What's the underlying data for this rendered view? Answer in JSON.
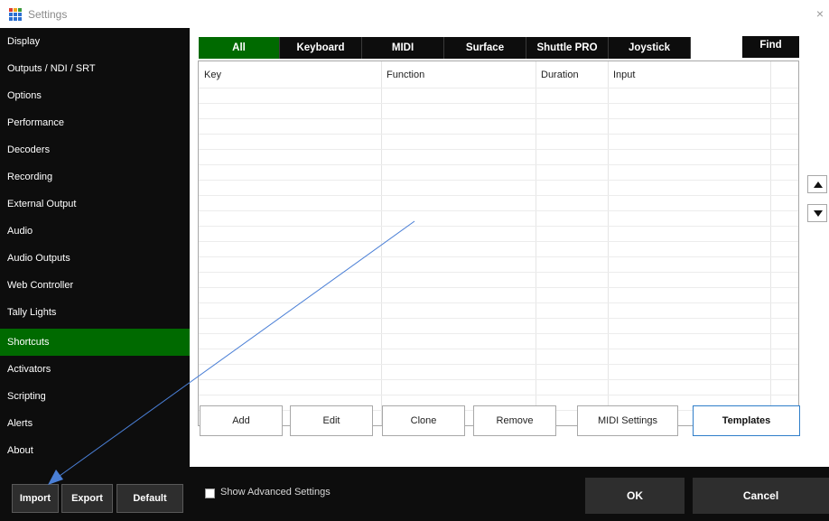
{
  "window": {
    "title": "Settings",
    "close_glyph": "×"
  },
  "sidebar": {
    "items": [
      {
        "label": "Display",
        "active": false
      },
      {
        "label": "Outputs / NDI / SRT",
        "active": false
      },
      {
        "label": "Options",
        "active": false
      },
      {
        "label": "Performance",
        "active": false
      },
      {
        "label": "Decoders",
        "active": false
      },
      {
        "label": "Recording",
        "active": false
      },
      {
        "label": "External Output",
        "active": false
      },
      {
        "label": "Audio",
        "active": false
      },
      {
        "label": "Audio Outputs",
        "active": false
      },
      {
        "label": "Web Controller",
        "active": false
      },
      {
        "label": "Tally Lights",
        "active": false
      },
      {
        "label": "Shortcuts",
        "active": true
      },
      {
        "label": "Activators",
        "active": false
      },
      {
        "label": "Scripting",
        "active": false
      },
      {
        "label": "Alerts",
        "active": false
      },
      {
        "label": "About",
        "active": false
      }
    ],
    "buttons": {
      "import": "Import",
      "export": "Export",
      "default": "Default"
    }
  },
  "tabs": {
    "items": [
      "All",
      "Keyboard",
      "MIDI",
      "Surface",
      "Shuttle PRO",
      "Joystick"
    ],
    "active": "All",
    "find_label": "Find"
  },
  "grid": {
    "columns": [
      "Key",
      "Function",
      "Duration",
      "Input"
    ],
    "rows": []
  },
  "scroll": {
    "up_icon": "triangle-up-icon",
    "down_icon": "triangle-down-icon"
  },
  "actions": {
    "add": "Add",
    "edit": "Edit",
    "clone": "Clone",
    "remove": "Remove",
    "midi_settings": "MIDI Settings",
    "templates": "Templates"
  },
  "footer": {
    "show_advanced_label": "Show Advanced Settings",
    "show_advanced_checked": false,
    "ok_label": "OK",
    "cancel_label": "Cancel"
  },
  "colors": {
    "sidebar_bg": "#0d0d0d",
    "active_green": "#006a00",
    "annotation_blue": "#4a7fd6",
    "primary_border": "#2f7ec9"
  }
}
